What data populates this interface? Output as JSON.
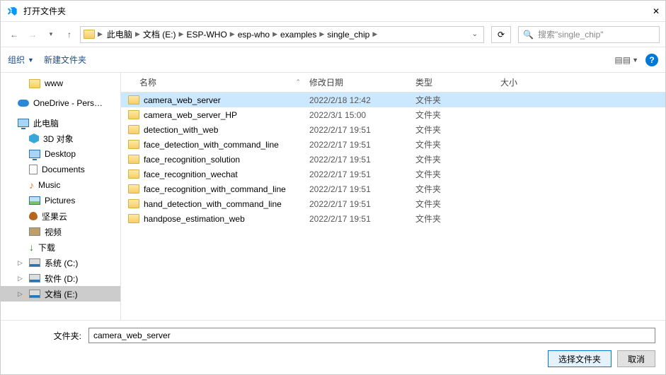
{
  "window": {
    "title": "打开文件夹",
    "close": "✕"
  },
  "breadcrumb": {
    "items": [
      "此电脑",
      "文档 (E:)",
      "ESP-WHO",
      "esp-who",
      "examples",
      "single_chip"
    ]
  },
  "search": {
    "placeholder": "搜索\"single_chip\""
  },
  "toolbar": {
    "organize": "组织",
    "newfolder": "新建文件夹"
  },
  "columns": {
    "name": "名称",
    "date": "修改日期",
    "type": "类型",
    "size": "大小"
  },
  "tree": [
    {
      "label": "www",
      "icon": "folder",
      "indent": 1
    },
    {
      "label": "OneDrive - Pers…",
      "icon": "cloud",
      "indent": 0,
      "root": true
    },
    {
      "label": "此电脑",
      "icon": "monitor",
      "indent": 0,
      "root": true
    },
    {
      "label": "3D 对象",
      "icon": "3d",
      "indent": 1
    },
    {
      "label": "Desktop",
      "icon": "monitor",
      "indent": 1
    },
    {
      "label": "Documents",
      "icon": "doc",
      "indent": 1
    },
    {
      "label": "Music",
      "icon": "music",
      "indent": 1
    },
    {
      "label": "Pictures",
      "icon": "pic",
      "indent": 1
    },
    {
      "label": "坚果云",
      "icon": "nut",
      "indent": 1
    },
    {
      "label": "视频",
      "icon": "vid",
      "indent": 1
    },
    {
      "label": "下载",
      "icon": "dl",
      "indent": 1
    },
    {
      "label": "系统 (C:)",
      "icon": "disk",
      "indent": 1,
      "exp": true
    },
    {
      "label": "软件 (D:)",
      "icon": "disk",
      "indent": 1,
      "exp": true
    },
    {
      "label": "文档 (E:)",
      "icon": "disk",
      "indent": 1,
      "exp": true,
      "sel": true
    }
  ],
  "files": [
    {
      "name": "camera_web_server",
      "date": "2022/2/18 12:42",
      "type": "文件夹",
      "sel": true
    },
    {
      "name": "camera_web_server_HP",
      "date": "2022/3/1 15:00",
      "type": "文件夹"
    },
    {
      "name": "detection_with_web",
      "date": "2022/2/17 19:51",
      "type": "文件夹"
    },
    {
      "name": "face_detection_with_command_line",
      "date": "2022/2/17 19:51",
      "type": "文件夹"
    },
    {
      "name": "face_recognition_solution",
      "date": "2022/2/17 19:51",
      "type": "文件夹"
    },
    {
      "name": "face_recognition_wechat",
      "date": "2022/2/17 19:51",
      "type": "文件夹"
    },
    {
      "name": "face_recognition_with_command_line",
      "date": "2022/2/17 19:51",
      "type": "文件夹"
    },
    {
      "name": "hand_detection_with_command_line",
      "date": "2022/2/17 19:51",
      "type": "文件夹"
    },
    {
      "name": "handpose_estimation_web",
      "date": "2022/2/17 19:51",
      "type": "文件夹"
    }
  ],
  "footer": {
    "label": "文件夹:",
    "value": "camera_web_server",
    "select": "选择文件夹",
    "cancel": "取消"
  }
}
